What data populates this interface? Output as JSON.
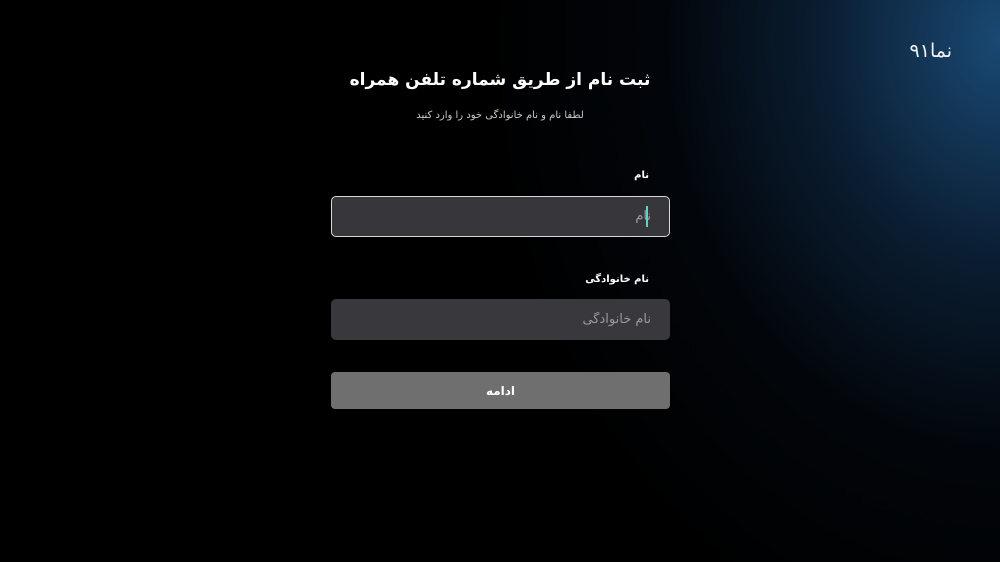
{
  "brand": {
    "logo_text": "نما۹۱"
  },
  "header": {
    "title": "ثبت نام از طریق شماره تلفن همراه",
    "subtitle": "لطفا نام و نام خانوادگی خود را وارد کنید"
  },
  "form": {
    "first_name": {
      "label": "نام",
      "placeholder": "نام",
      "value": ""
    },
    "last_name": {
      "label": "نام خانوادگی",
      "placeholder": "نام خانوادگی",
      "value": ""
    },
    "submit_label": "ادامه"
  },
  "colors": {
    "background": "#000000",
    "glow": "#1e5587",
    "input_bg": "#38383d",
    "focused_border": "#d8d8d8",
    "caret": "#5fd1c6",
    "button_bg": "#6f6f6f"
  }
}
